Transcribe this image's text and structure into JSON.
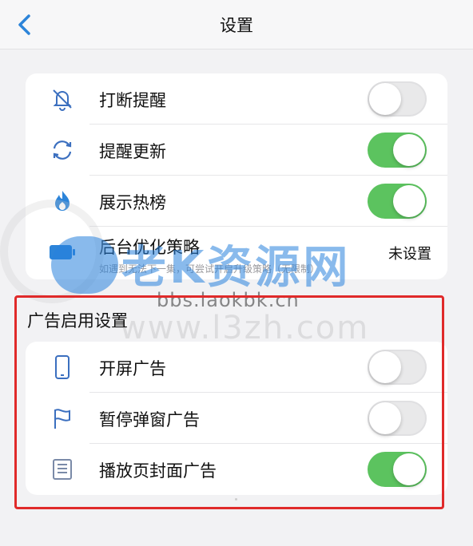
{
  "nav": {
    "title": "设置",
    "back_icon": "chevron-left-icon",
    "accent": "#2c84d9"
  },
  "top_settings": [
    {
      "label": "打断提醒",
      "icon": "bell-off-icon",
      "toggle": false
    },
    {
      "label": "提醒更新",
      "icon": "refresh-icon",
      "toggle": true
    },
    {
      "label": "展示热榜",
      "icon": "flame-icon",
      "toggle": true
    }
  ],
  "background_strategy": {
    "label": "后台优化策略",
    "icon": "battery-icon",
    "hint": "如遇到无法下一集，可尝试开启升级策略（无限制）",
    "value": "未设置"
  },
  "ads_section": {
    "title": "广告启用设置",
    "items": [
      {
        "label": "开屏广告",
        "icon": "phone-icon",
        "toggle": false
      },
      {
        "label": "暂停弹窗广告",
        "icon": "flag-icon",
        "toggle": false
      },
      {
        "label": "播放页封面广告",
        "icon": "document-icon",
        "toggle": true
      }
    ]
  },
  "watermark": {
    "brand": "老K资源网",
    "url1": "bbs.laokbk.cn",
    "url2": "www.l3zh.com"
  },
  "colors": {
    "toggle_on": "#5cc35f",
    "highlight": "#e02a2a"
  }
}
